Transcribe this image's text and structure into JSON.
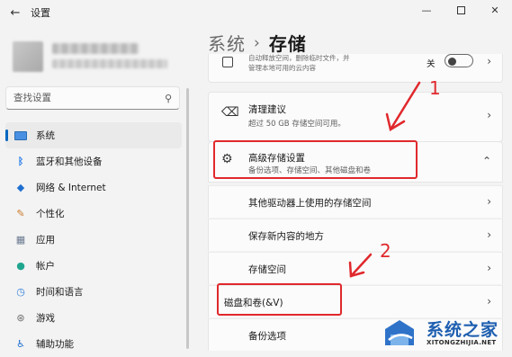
{
  "window": {
    "title": "设置",
    "back_glyph": "←",
    "minimize_glyph": "—",
    "close_glyph": "✕"
  },
  "sidebar": {
    "search_placeholder": "查找设置",
    "items": [
      {
        "label": "系统",
        "icon": "system-icon",
        "selected": true
      },
      {
        "label": "蓝牙和其他设备",
        "icon": "bluetooth-icon"
      },
      {
        "label": "网络 & Internet",
        "icon": "wifi-icon"
      },
      {
        "label": "个性化",
        "icon": "brush-icon"
      },
      {
        "label": "应用",
        "icon": "apps-icon"
      },
      {
        "label": "帐户",
        "icon": "account-icon"
      },
      {
        "label": "时间和语言",
        "icon": "clock-icon"
      },
      {
        "label": "游戏",
        "icon": "game-icon"
      },
      {
        "label": "辅助功能",
        "icon": "accessibility-icon"
      }
    ]
  },
  "breadcrumb": {
    "parent": "系统",
    "separator": "›",
    "current": "存储"
  },
  "storage_sense": {
    "subtitle_line1": "自动释放空间，删除临时文件，并",
    "subtitle_line2": "管理本地可用的云内容",
    "toggle_label": "关",
    "toggle_on": false
  },
  "cleanup": {
    "title": "清理建议",
    "subtitle": "超过 50 GB 存储空间可用。"
  },
  "advanced": {
    "title": "高级存储设置",
    "subtitle": "备份选项、存储空间、其他磁盘和卷",
    "expanded": true,
    "expanded_glyph": "⌃",
    "items": [
      {
        "label": "其他驱动器上使用的存储空间"
      },
      {
        "label": "保存新内容的地方"
      },
      {
        "label": "存储空间"
      },
      {
        "label": "磁盘和卷(&V)"
      },
      {
        "label": "备份选项"
      }
    ]
  },
  "annotations": {
    "num1": "1",
    "num2": "2",
    "color": "#e0282c"
  },
  "watermark": {
    "title": "系统之家",
    "url": "XITONGZHIJIA.NET"
  },
  "colors": {
    "accent": "#0067c0",
    "annotation_red": "#e0282c",
    "watermark_blue": "#1e5fb0"
  }
}
